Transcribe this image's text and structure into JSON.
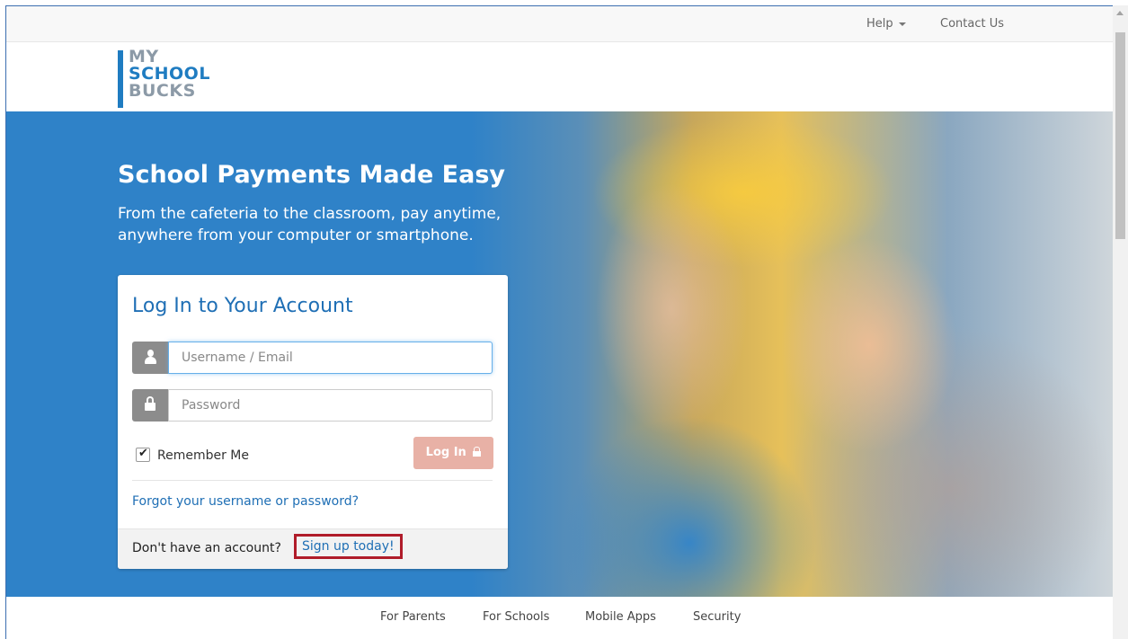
{
  "topbar": {
    "help_label": "Help",
    "contact_label": "Contact Us"
  },
  "logo": {
    "line1": "MY",
    "line2": "SCHOOL",
    "line3": "BUCKS"
  },
  "hero": {
    "headline": "School Payments Made Easy",
    "subtext": "From the cafeteria to the classroom, pay anytime, anywhere from your computer or smartphone."
  },
  "login": {
    "title": "Log In to Your Account",
    "username_placeholder": "Username / Email",
    "password_placeholder": "Password",
    "remember_label": "Remember Me",
    "remember_checked": true,
    "login_button": "Log In",
    "forgot_link": "Forgot your username or password?",
    "no_account_text": "Don't have an account?",
    "signup_link": "Sign up today!"
  },
  "bottom_nav": {
    "items": [
      "For Parents",
      "For Schools",
      "Mobile Apps",
      "Security"
    ]
  },
  "colors": {
    "brand_blue": "#1f6fb5",
    "hero_blue": "#2f82c8",
    "login_button_bg": "#e8b1a6",
    "highlight_box": "#b01c2a"
  }
}
